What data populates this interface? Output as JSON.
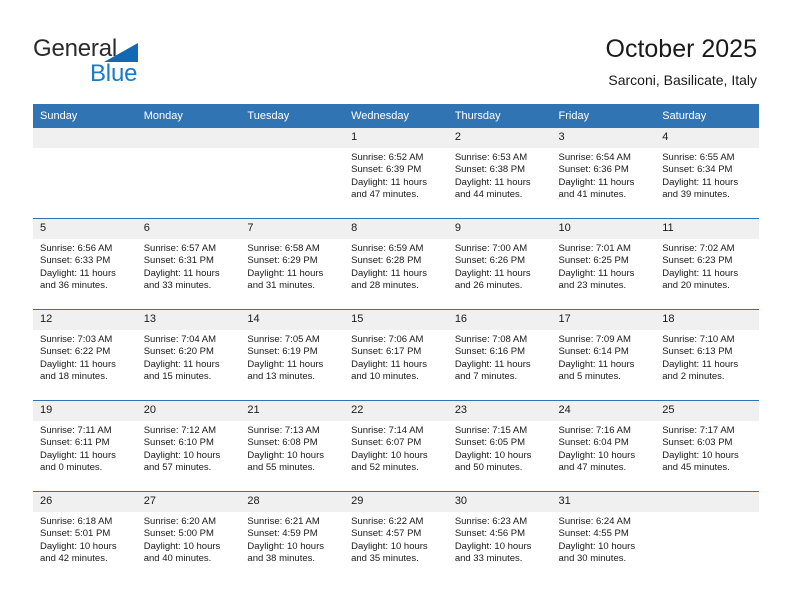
{
  "brand": {
    "word1": "General",
    "word2": "Blue",
    "triangle_color": "#1268b3",
    "blue_color": "#1a79c8"
  },
  "header": {
    "title": "October 2025",
    "location": "Sarconi, Basilicate, Italy"
  },
  "calendar": {
    "header_bg": "#3174b4",
    "daynum_bg": "#f0f0f0",
    "weekdays": [
      "Sunday",
      "Monday",
      "Tuesday",
      "Wednesday",
      "Thursday",
      "Friday",
      "Saturday"
    ],
    "weeks": [
      [
        {
          "day": "",
          "empty": true
        },
        {
          "day": "",
          "empty": true
        },
        {
          "day": "",
          "empty": true
        },
        {
          "day": "1",
          "sunrise": "Sunrise: 6:52 AM",
          "sunset": "Sunset: 6:39 PM",
          "daylight1": "Daylight: 11 hours",
          "daylight2": "and 47 minutes."
        },
        {
          "day": "2",
          "sunrise": "Sunrise: 6:53 AM",
          "sunset": "Sunset: 6:38 PM",
          "daylight1": "Daylight: 11 hours",
          "daylight2": "and 44 minutes."
        },
        {
          "day": "3",
          "sunrise": "Sunrise: 6:54 AM",
          "sunset": "Sunset: 6:36 PM",
          "daylight1": "Daylight: 11 hours",
          "daylight2": "and 41 minutes."
        },
        {
          "day": "4",
          "sunrise": "Sunrise: 6:55 AM",
          "sunset": "Sunset: 6:34 PM",
          "daylight1": "Daylight: 11 hours",
          "daylight2": "and 39 minutes."
        }
      ],
      [
        {
          "day": "5",
          "sunrise": "Sunrise: 6:56 AM",
          "sunset": "Sunset: 6:33 PM",
          "daylight1": "Daylight: 11 hours",
          "daylight2": "and 36 minutes."
        },
        {
          "day": "6",
          "sunrise": "Sunrise: 6:57 AM",
          "sunset": "Sunset: 6:31 PM",
          "daylight1": "Daylight: 11 hours",
          "daylight2": "and 33 minutes."
        },
        {
          "day": "7",
          "sunrise": "Sunrise: 6:58 AM",
          "sunset": "Sunset: 6:29 PM",
          "daylight1": "Daylight: 11 hours",
          "daylight2": "and 31 minutes."
        },
        {
          "day": "8",
          "sunrise": "Sunrise: 6:59 AM",
          "sunset": "Sunset: 6:28 PM",
          "daylight1": "Daylight: 11 hours",
          "daylight2": "and 28 minutes."
        },
        {
          "day": "9",
          "sunrise": "Sunrise: 7:00 AM",
          "sunset": "Sunset: 6:26 PM",
          "daylight1": "Daylight: 11 hours",
          "daylight2": "and 26 minutes."
        },
        {
          "day": "10",
          "sunrise": "Sunrise: 7:01 AM",
          "sunset": "Sunset: 6:25 PM",
          "daylight1": "Daylight: 11 hours",
          "daylight2": "and 23 minutes."
        },
        {
          "day": "11",
          "sunrise": "Sunrise: 7:02 AM",
          "sunset": "Sunset: 6:23 PM",
          "daylight1": "Daylight: 11 hours",
          "daylight2": "and 20 minutes."
        }
      ],
      [
        {
          "day": "12",
          "sunrise": "Sunrise: 7:03 AM",
          "sunset": "Sunset: 6:22 PM",
          "daylight1": "Daylight: 11 hours",
          "daylight2": "and 18 minutes."
        },
        {
          "day": "13",
          "sunrise": "Sunrise: 7:04 AM",
          "sunset": "Sunset: 6:20 PM",
          "daylight1": "Daylight: 11 hours",
          "daylight2": "and 15 minutes."
        },
        {
          "day": "14",
          "sunrise": "Sunrise: 7:05 AM",
          "sunset": "Sunset: 6:19 PM",
          "daylight1": "Daylight: 11 hours",
          "daylight2": "and 13 minutes."
        },
        {
          "day": "15",
          "sunrise": "Sunrise: 7:06 AM",
          "sunset": "Sunset: 6:17 PM",
          "daylight1": "Daylight: 11 hours",
          "daylight2": "and 10 minutes."
        },
        {
          "day": "16",
          "sunrise": "Sunrise: 7:08 AM",
          "sunset": "Sunset: 6:16 PM",
          "daylight1": "Daylight: 11 hours",
          "daylight2": "and 7 minutes."
        },
        {
          "day": "17",
          "sunrise": "Sunrise: 7:09 AM",
          "sunset": "Sunset: 6:14 PM",
          "daylight1": "Daylight: 11 hours",
          "daylight2": "and 5 minutes."
        },
        {
          "day": "18",
          "sunrise": "Sunrise: 7:10 AM",
          "sunset": "Sunset: 6:13 PM",
          "daylight1": "Daylight: 11 hours",
          "daylight2": "and 2 minutes."
        }
      ],
      [
        {
          "day": "19",
          "sunrise": "Sunrise: 7:11 AM",
          "sunset": "Sunset: 6:11 PM",
          "daylight1": "Daylight: 11 hours",
          "daylight2": "and 0 minutes."
        },
        {
          "day": "20",
          "sunrise": "Sunrise: 7:12 AM",
          "sunset": "Sunset: 6:10 PM",
          "daylight1": "Daylight: 10 hours",
          "daylight2": "and 57 minutes."
        },
        {
          "day": "21",
          "sunrise": "Sunrise: 7:13 AM",
          "sunset": "Sunset: 6:08 PM",
          "daylight1": "Daylight: 10 hours",
          "daylight2": "and 55 minutes."
        },
        {
          "day": "22",
          "sunrise": "Sunrise: 7:14 AM",
          "sunset": "Sunset: 6:07 PM",
          "daylight1": "Daylight: 10 hours",
          "daylight2": "and 52 minutes."
        },
        {
          "day": "23",
          "sunrise": "Sunrise: 7:15 AM",
          "sunset": "Sunset: 6:05 PM",
          "daylight1": "Daylight: 10 hours",
          "daylight2": "and 50 minutes."
        },
        {
          "day": "24",
          "sunrise": "Sunrise: 7:16 AM",
          "sunset": "Sunset: 6:04 PM",
          "daylight1": "Daylight: 10 hours",
          "daylight2": "and 47 minutes."
        },
        {
          "day": "25",
          "sunrise": "Sunrise: 7:17 AM",
          "sunset": "Sunset: 6:03 PM",
          "daylight1": "Daylight: 10 hours",
          "daylight2": "and 45 minutes."
        }
      ],
      [
        {
          "day": "26",
          "sunrise": "Sunrise: 6:18 AM",
          "sunset": "Sunset: 5:01 PM",
          "daylight1": "Daylight: 10 hours",
          "daylight2": "and 42 minutes."
        },
        {
          "day": "27",
          "sunrise": "Sunrise: 6:20 AM",
          "sunset": "Sunset: 5:00 PM",
          "daylight1": "Daylight: 10 hours",
          "daylight2": "and 40 minutes."
        },
        {
          "day": "28",
          "sunrise": "Sunrise: 6:21 AM",
          "sunset": "Sunset: 4:59 PM",
          "daylight1": "Daylight: 10 hours",
          "daylight2": "and 38 minutes."
        },
        {
          "day": "29",
          "sunrise": "Sunrise: 6:22 AM",
          "sunset": "Sunset: 4:57 PM",
          "daylight1": "Daylight: 10 hours",
          "daylight2": "and 35 minutes."
        },
        {
          "day": "30",
          "sunrise": "Sunrise: 6:23 AM",
          "sunset": "Sunset: 4:56 PM",
          "daylight1": "Daylight: 10 hours",
          "daylight2": "and 33 minutes."
        },
        {
          "day": "31",
          "sunrise": "Sunrise: 6:24 AM",
          "sunset": "Sunset: 4:55 PM",
          "daylight1": "Daylight: 10 hours",
          "daylight2": "and 30 minutes."
        },
        {
          "day": "",
          "empty": true
        }
      ]
    ]
  }
}
